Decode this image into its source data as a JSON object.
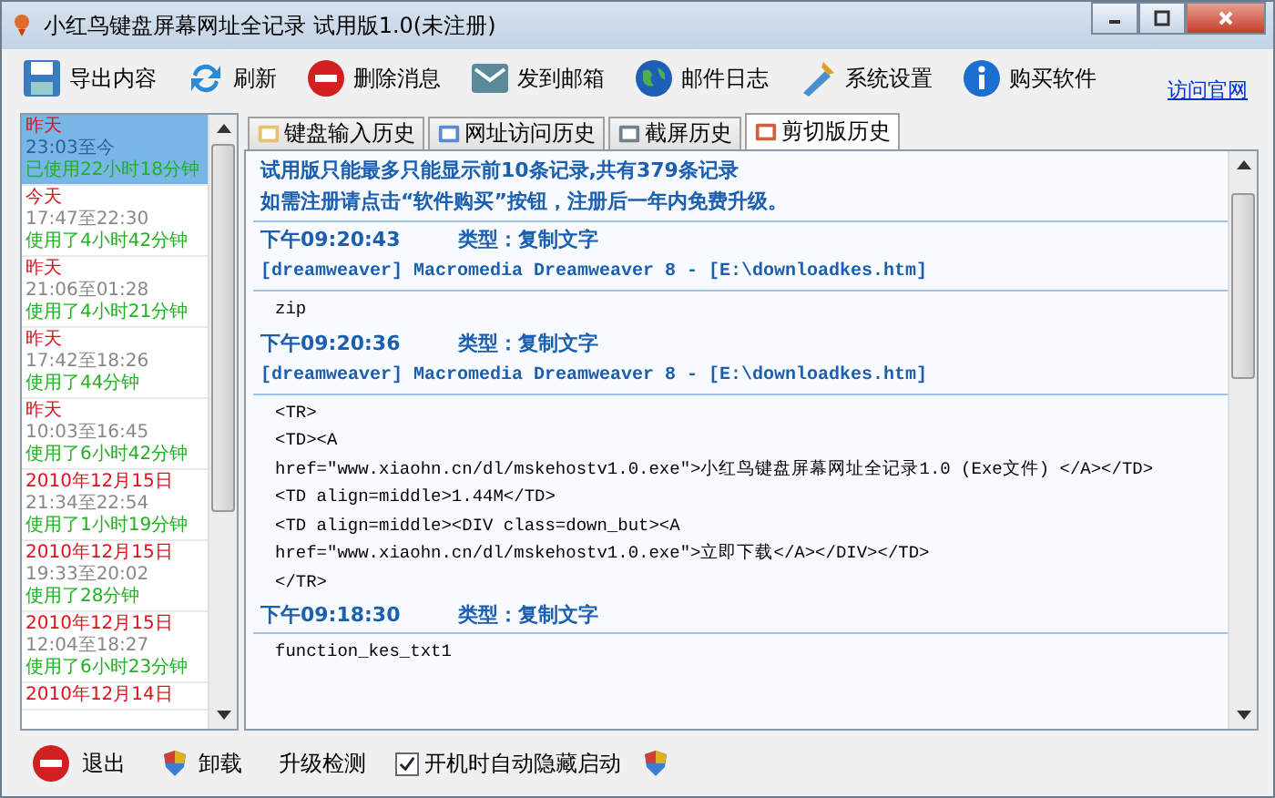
{
  "window": {
    "title": "小红鸟键盘屏幕网址全记录 试用版1.0(未注册)"
  },
  "toolbar": [
    {
      "label": "导出内容",
      "kind": "save"
    },
    {
      "label": "刷新",
      "kind": "refresh"
    },
    {
      "label": "删除消息",
      "kind": "delete"
    },
    {
      "label": "发到邮箱",
      "kind": "mail"
    },
    {
      "label": "邮件日志",
      "kind": "globe"
    },
    {
      "label": "系统设置",
      "kind": "settings"
    },
    {
      "label": "购买软件",
      "kind": "info"
    }
  ],
  "site_link": "访问官网",
  "sessions": [
    {
      "day": "昨天",
      "time": "23:03至今",
      "duration": "已使用22小时18分钟",
      "selected": true
    },
    {
      "day": "今天",
      "time": "17:47至22:30",
      "duration": "使用了4小时42分钟",
      "selected": false
    },
    {
      "day": "昨天",
      "time": "21:06至01:28",
      "duration": "使用了4小时21分钟",
      "selected": false
    },
    {
      "day": "昨天",
      "time": "17:42至18:26",
      "duration": "使用了44分钟",
      "selected": false
    },
    {
      "day": "昨天",
      "time": "10:03至16:45",
      "duration": "使用了6小时42分钟",
      "selected": false
    },
    {
      "day": "2010年12月15日",
      "time": "21:34至22:54",
      "duration": "使用了1小时19分钟",
      "selected": false
    },
    {
      "day": "2010年12月15日",
      "time": "19:33至20:02",
      "duration": "使用了28分钟",
      "selected": false
    },
    {
      "day": "2010年12月15日",
      "time": "12:04至18:27",
      "duration": "使用了6小时23分钟",
      "selected": false
    },
    {
      "day": "2010年12月14日",
      "selected": false
    }
  ],
  "tabs": [
    {
      "label": "键盘输入历史",
      "selected": false
    },
    {
      "label": "网址访问历史",
      "selected": false
    },
    {
      "label": "截屏历史",
      "selected": false
    },
    {
      "label": "剪切版历史",
      "selected": true
    }
  ],
  "notice": [
    "试用版只能最多只能显示前10条记录,共有379条记录",
    "如需注册请点击“软件购买”按钮，注册后一年内免费升级。"
  ],
  "records": [
    {
      "time": "下午09:20:43",
      "type": "类型：复制文字",
      "source": "[dreamweaver]  Macromedia Dreamweaver 8 - [E:\\downloadkes.htm]",
      "content": [
        "zip"
      ]
    },
    {
      "time": "下午09:20:36",
      "type": "类型：复制文字",
      "source": "[dreamweaver]  Macromedia Dreamweaver 8 - [E:\\downloadkes.htm]",
      "content": [
        "<TR>",
        "<TD><A",
        "href=\"www.xiaohn.cn/dl/mskehostv1.0.exe\">小红鸟键盘屏幕网址全记录1.0 (Exe文件) </A></TD>",
        "<TD align=middle>1.44M</TD>",
        "<TD align=middle><DIV class=down_but><A",
        "href=\"www.xiaohn.cn/dl/mskehostv1.0.exe\">立即下载</A></DIV></TD>",
        "</TR>"
      ]
    },
    {
      "time": "下午09:18:30",
      "type": "类型：复制文字",
      "content": [
        "function_kes_txt1"
      ]
    }
  ],
  "bottom": {
    "exit": "退出",
    "uninstall": "卸载",
    "update": "升级检测",
    "autostart": {
      "label": "开机时自动隐藏启动",
      "checked": true
    }
  }
}
